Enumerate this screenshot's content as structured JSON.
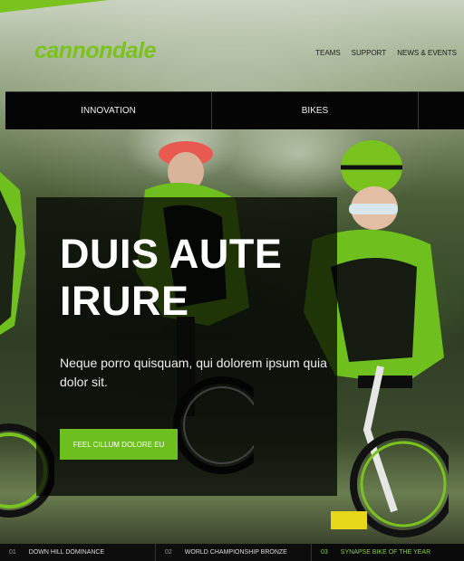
{
  "brand": {
    "logo_text": "cannondale",
    "accent_color": "#7ac31e"
  },
  "top_links": [
    "TEAMS",
    "SUPPORT",
    "NEWS & EVENTS"
  ],
  "nav": {
    "items": [
      "INNOVATION",
      "BIKES",
      ""
    ]
  },
  "hero": {
    "headline": "DUIS AUTE IRURE",
    "subcopy": "Neque porro quisquam, qui dolorem ipsum quia dolor sit.",
    "cta_label": "FEEL CILLUM DOLORE EU"
  },
  "slides": [
    {
      "num": "01",
      "label": "DOWN HILL DOMINANCE"
    },
    {
      "num": "02",
      "label": "WORLD CHAMPIONSHIP BRONZE"
    },
    {
      "num": "03",
      "label": "SYNAPSE BIKE OF THE YEAR"
    }
  ]
}
